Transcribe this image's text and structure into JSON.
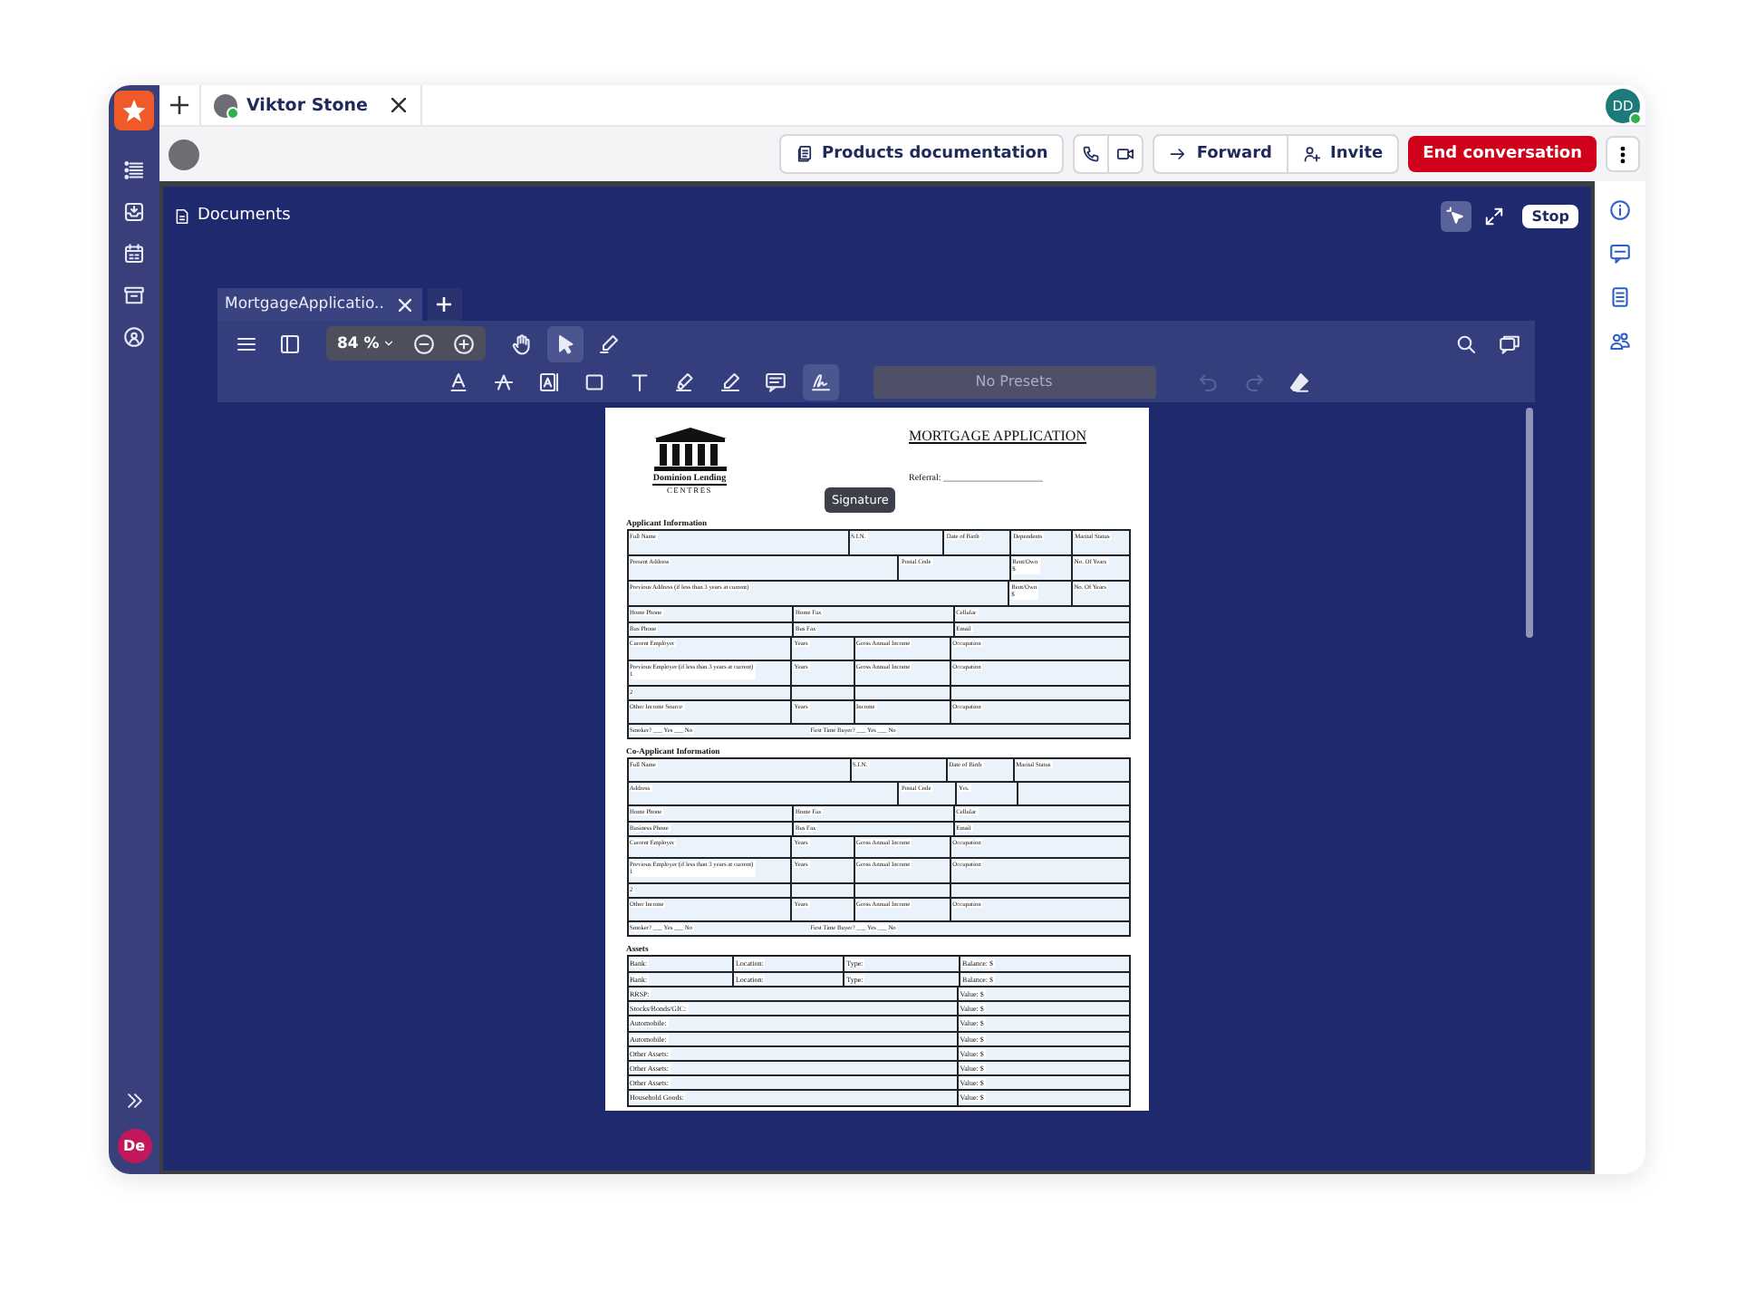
{
  "rail": {
    "items": [
      {
        "kind": "list"
      },
      {
        "kind": "inbox"
      },
      {
        "kind": "calendar"
      },
      {
        "kind": "archive"
      },
      {
        "kind": "broadcast"
      }
    ],
    "expand": {
      "kind": "chevrons"
    },
    "user_initials": "De"
  },
  "tabs": [
    {
      "label": "Viktor Stone",
      "selected": true,
      "online": true
    }
  ],
  "account": {
    "initials": "DD",
    "online": true
  },
  "actions": [
    {
      "kind": "docs",
      "label": "Products documentation"
    },
    {
      "kind": "phone"
    },
    {
      "kind": "video"
    },
    {
      "kind": "forward",
      "label": "Forward"
    },
    {
      "kind": "invite",
      "label": "Invite"
    },
    {
      "kind": "end",
      "label": "End conversation"
    },
    {
      "kind": "more"
    }
  ],
  "panel": {
    "title": "Documents",
    "stop_label": "Stop"
  },
  "viewer": {
    "tabs": [
      {
        "label": "MortgageApplicatio..",
        "selected": true
      }
    ],
    "nav_tools": [
      {
        "kind": "menu"
      },
      {
        "kind": "panel"
      }
    ],
    "zoom": {
      "value": "84 %",
      "buttons": [
        {
          "kind": "zoom-out"
        },
        {
          "kind": "zoom-in"
        }
      ]
    },
    "modes": [
      {
        "kind": "hand",
        "selected": false
      },
      {
        "kind": "pointer",
        "selected": true
      },
      {
        "kind": "pen",
        "selected": false
      }
    ],
    "side_tools": [
      {
        "kind": "search"
      },
      {
        "kind": "comments"
      }
    ],
    "annotation_tools": [
      {
        "kind": "underline",
        "selected": false
      },
      {
        "kind": "strike",
        "selected": false
      },
      {
        "kind": "textbox",
        "selected": false
      },
      {
        "kind": "rectangle",
        "selected": false
      },
      {
        "kind": "text",
        "selected": false
      },
      {
        "kind": "highlighter",
        "selected": false
      },
      {
        "kind": "ink",
        "selected": false
      },
      {
        "kind": "note",
        "selected": false
      },
      {
        "kind": "signature",
        "selected": true
      }
    ],
    "presets": "No Presets",
    "history": [
      {
        "kind": "undo",
        "disabled": true
      },
      {
        "kind": "redo",
        "disabled": true
      },
      {
        "kind": "eraser",
        "disabled": false
      }
    ],
    "tooltip": "Signature"
  },
  "document": {
    "logo": {
      "name": "Dominion Lending",
      "tagline": "CENTRES"
    },
    "title": "MORTGAGE APPLICATION",
    "referral": "Referral: ______________________",
    "sections": [
      {
        "heading": "Applicant Information",
        "lines": [
          {
            "fields": [
              "Full Name",
              "S.I.N.",
              "Date of Birth",
              "Dependents",
              "Marital Status"
            ]
          },
          {
            "fields": [
              "Present Address",
              "Postal Code",
              "Rent/Own\n$",
              "No. Of Years"
            ]
          },
          {
            "fields": [
              "Previous Address (if less than 3 years at current)",
              "Rent/Own\n$",
              "No. Of Years"
            ]
          },
          {
            "fields": [
              "Home Phone",
              "Home Fax",
              "Cellular"
            ]
          },
          {
            "fields": [
              "Bus Phone",
              "Bus Fax",
              "Email"
            ]
          },
          {
            "fields": [
              "Current Employer",
              "Years",
              "Gross Annual Income",
              "Occupation"
            ]
          },
          {
            "fields": [
              "Previous Employer (if less than 3 years at current)\n1",
              "Years",
              "Gross Annual Income",
              "Occupation"
            ]
          },
          {
            "fields": [
              "2"
            ]
          },
          {
            "fields": [
              "Other Income Source",
              "Years",
              "Income",
              "Occupation"
            ]
          },
          {
            "fields": [
              "Smoker? ___ Yes ___ No",
              "First Time Buyer? ___ Yes ___ No"
            ]
          }
        ]
      },
      {
        "heading": "Co-Applicant Information",
        "lines": [
          {
            "fields": [
              "Full Name",
              "S.I.N.",
              "Date of Birth",
              "Marital Status"
            ]
          },
          {
            "fields": [
              "Address",
              "Postal Code",
              "Yrs."
            ]
          },
          {
            "fields": [
              "Home Phone",
              "Home Fax",
              "Cellular"
            ]
          },
          {
            "fields": [
              "Business Phone",
              "Bus Fax",
              "Email"
            ]
          },
          {
            "fields": [
              "Current Employer",
              "Years",
              "Gross Annual Income",
              "Occupation"
            ]
          },
          {
            "fields": [
              "Previous Employer (if less than 3 years at current)\n1",
              "Years",
              "Gross Annual Income",
              "Occupation"
            ]
          },
          {
            "fields": [
              "2"
            ]
          },
          {
            "fields": [
              "Other Income",
              "Years",
              "Gross Annual Income",
              "Occupation"
            ]
          },
          {
            "fields": [
              "Smoker? ___ Yes ___ No",
              "First Time Buyer? ___ Yes ___ No"
            ]
          }
        ]
      },
      {
        "heading": "Assets",
        "lines": [
          {
            "fields": [
              "Bank:",
              "Location:",
              "Type:",
              "Balance: $"
            ]
          },
          {
            "fields": [
              "Bank:",
              "Location:",
              "Type:",
              "Balance: $"
            ]
          },
          {
            "fields": [
              "RRSP:",
              "Value: $"
            ]
          },
          {
            "fields": [
              "Stocks/Bonds/GIC:",
              "Value: $"
            ]
          },
          {
            "fields": [
              "Automobile:",
              "Value: $"
            ]
          },
          {
            "fields": [
              "Automobile:",
              "Value: $"
            ]
          },
          {
            "fields": [
              "Other Assets:",
              "Value: $"
            ]
          },
          {
            "fields": [
              "Other Assets:",
              "Value: $"
            ]
          },
          {
            "fields": [
              "Other Assets:",
              "Value: $"
            ]
          },
          {
            "fields": [
              "Household Goods:",
              "Value: $"
            ]
          }
        ]
      }
    ]
  },
  "right_sidebar": {
    "items": [
      {
        "kind": "info"
      },
      {
        "kind": "chat"
      },
      {
        "kind": "notes"
      },
      {
        "kind": "people"
      }
    ]
  }
}
